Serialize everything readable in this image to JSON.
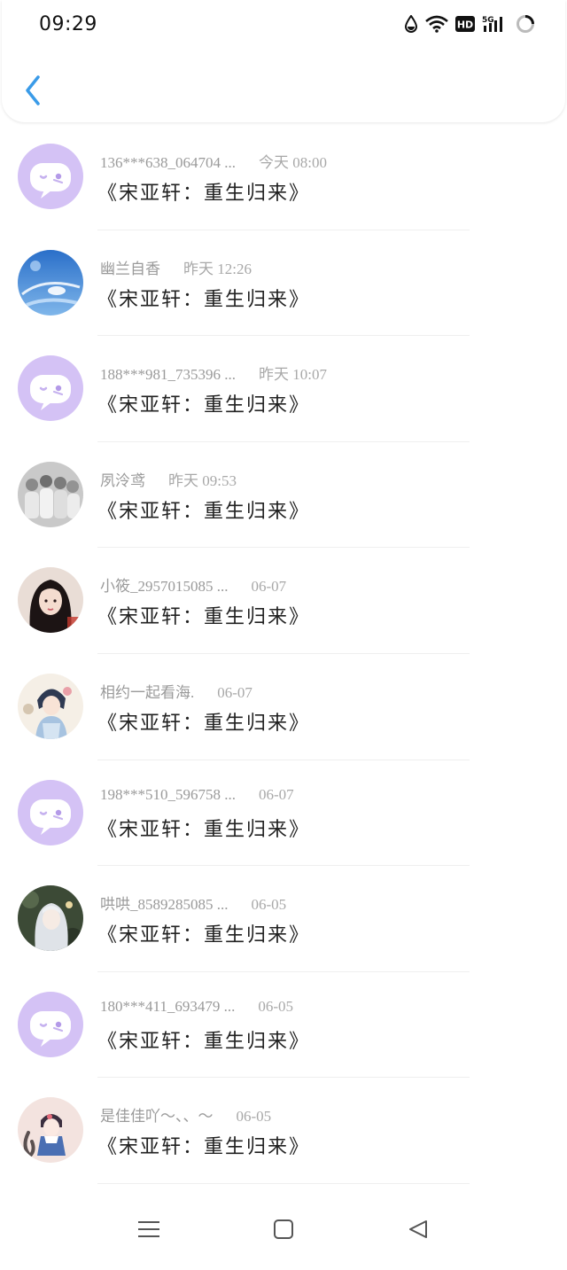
{
  "status_bar": {
    "time": "09:29",
    "icons": [
      "water-drop-icon",
      "wifi-icon",
      "hd-icon",
      "5g-signal-icon",
      "battery-icon"
    ],
    "network_label": "5G",
    "hd_label": "HD"
  },
  "header": {
    "back_icon": "chevron-left-icon",
    "accent_color": "#3a9be8"
  },
  "messages": [
    {
      "name": "136***638_064704 ...",
      "time": "今天 08:00",
      "title": "《宋亚轩：重生归来》",
      "avatar": "default-chat-avatar"
    },
    {
      "name": "幽兰自香",
      "time": "昨天 12:26",
      "title": "《宋亚轩：重生归来》",
      "avatar": "sky-photo-avatar"
    },
    {
      "name": "188***981_735396 ...",
      "time": "昨天 10:07",
      "title": "《宋亚轩：重生归来》",
      "avatar": "default-chat-avatar"
    },
    {
      "name": "夙泠鸢",
      "time": "昨天 09:53",
      "title": "《宋亚轩：重生归来》",
      "avatar": "group-photo-avatar"
    },
    {
      "name": "小筱_2957015085 ...",
      "time": "06-07",
      "title": "《宋亚轩：重生归来》",
      "avatar": "girl-photo-avatar"
    },
    {
      "name": "相约一起看海.",
      "time": "06-07",
      "title": "《宋亚轩：重生归来》",
      "avatar": "anime-girl-avatar"
    },
    {
      "name": "198***510_596758 ...",
      "time": "06-07",
      "title": "《宋亚轩：重生归来》",
      "avatar": "default-chat-avatar"
    },
    {
      "name": "哄哄_8589285085 ...",
      "time": "06-05",
      "title": "《宋亚轩：重生归来》",
      "avatar": "anime-silver-avatar"
    },
    {
      "name": "180***411_693479 ...",
      "time": "06-05",
      "title": "《宋亚轩：重生归来》",
      "avatar": "default-chat-avatar"
    },
    {
      "name": "是佳佳吖～、、～",
      "time": "06-05",
      "title": "《宋亚轩：重生归来》",
      "avatar": "anime-cat-avatar"
    }
  ],
  "colors": {
    "default_avatar_bg": "#d4c2f5",
    "name_text": "#9a9a9a",
    "title_text": "#222222"
  },
  "nav_bar": {
    "icons": [
      "menu-icon",
      "home-square-icon",
      "back-triangle-icon"
    ]
  }
}
